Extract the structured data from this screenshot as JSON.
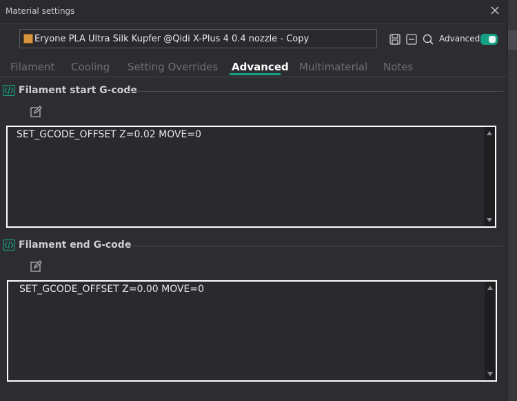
{
  "window": {
    "title": "Material settings"
  },
  "preset": {
    "name": "Eryone PLA Ultra Silk Kupfer @Qidi X-Plus 4 0.4 nozzle - Copy",
    "swatch_color": "#d8933f"
  },
  "toolbar": {
    "advanced_label": "Advanced",
    "advanced_on": true
  },
  "tabs": [
    {
      "label": "Filament"
    },
    {
      "label": "Cooling"
    },
    {
      "label": "Setting Overrides"
    },
    {
      "label": "Advanced"
    },
    {
      "label": "Multimaterial"
    },
    {
      "label": "Notes"
    }
  ],
  "active_tab": "Advanced",
  "sections": {
    "start": {
      "title": "Filament start G-code",
      "code": "SET_GCODE_OFFSET Z=0.02 MOVE=0"
    },
    "end": {
      "title": "Filament end G-code",
      "code": "SET_GCODE_OFFSET Z=0.00 MOVE=0"
    }
  },
  "colors": {
    "accent": "#14a085",
    "background": "#2d2d31"
  }
}
